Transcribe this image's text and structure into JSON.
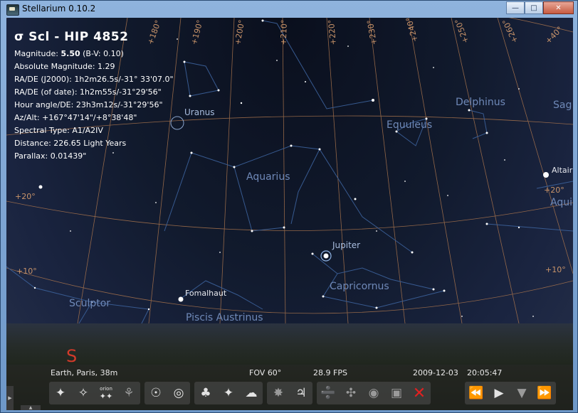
{
  "window": {
    "title": "Stellarium 0.10.2",
    "minimize": "—",
    "maximize": "□",
    "close": "✕"
  },
  "info": {
    "title": "σ Scl - HIP 4852",
    "magnitude_label": "Magnitude: ",
    "magnitude_value": "5.50",
    "magnitude_bv": " (B-V: 0.10)",
    "absolute_magnitude": "Absolute Magnitude: 1.29",
    "ra_de_j2000": "RA/DE (J2000): 1h2m26.5s/-31° 33'07.0\"",
    "ra_de_date": "RA/DE (of date): 1h2m55s/-31°29'56\"",
    "hour_angle": "Hour angle/DE: 23h3m12s/-31°29'56\"",
    "az_alt": "Az/Alt: +167°47'14\"/+8°38'48\"",
    "spectral_type": "Spectral Type: A1/A2IV",
    "distance": "Distance: 226.65 Light Years",
    "parallax": "Parallax: 0.01439\""
  },
  "labels": {
    "constellations": [
      "Aquarius",
      "Equuleus",
      "Delphinus",
      "Capricornus",
      "Sculptor",
      "Piscis Austrinus",
      "Sag",
      "Aqui"
    ],
    "planets": [
      "Uranus",
      "Jupiter"
    ],
    "stars": [
      "Fomalhaut",
      "Altair"
    ]
  },
  "grid_labels": {
    "azimuth": [
      "+180°",
      "+190°",
      "+200°",
      "+210°",
      "+220°",
      "+230°",
      "+240°",
      "+250°",
      "+260°",
      "+40°"
    ],
    "altitude": [
      "+20°",
      "+10°",
      "+20°",
      "+10°"
    ]
  },
  "cardinal": "S",
  "status": {
    "location": "Earth, Paris, 38m",
    "fov": "FOV 60°",
    "fps": "28.9 FPS",
    "date": "2009-12-03",
    "time": "20:05:47"
  },
  "toolbar": {
    "orion_label": "orion",
    "buttons": [
      "constellation-lines-button",
      "constellation-labels-button",
      "constellation-art-button",
      "constellation-boundaries-button",
      "equatorial-grid-button",
      "azimuthal-grid-button",
      "ground-button",
      "cardinal-points-button",
      "atmosphere-button",
      "nebulae-button",
      "planet-labels-button",
      "equatorial-mount-button",
      "center-on-selected-button",
      "night-mode-button",
      "fullscreen-button",
      "quit-button",
      "decrease-time-speed-button",
      "real-time-speed-button",
      "set-time-now-button",
      "increase-time-speed-button"
    ]
  },
  "colors": {
    "sky_top": "#0a0f1d",
    "grid_line": "#a9744d",
    "constellation_line": "#3a5e96",
    "constellation_label": "#6f89b8",
    "cardinal_red": "#d23a2a",
    "close_red": "#e12121"
  }
}
